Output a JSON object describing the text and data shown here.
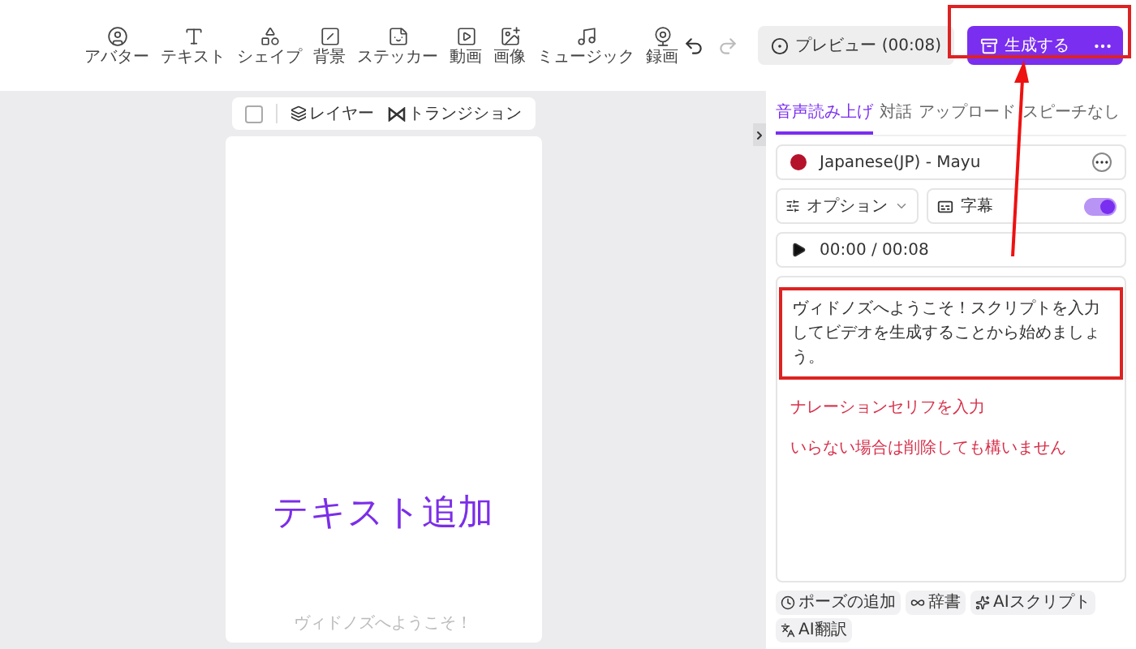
{
  "toolbar": {
    "items": [
      {
        "label": "アバター"
      },
      {
        "label": "テキスト"
      },
      {
        "label": "シェイプ"
      },
      {
        "label": "背景"
      },
      {
        "label": "ステッカー"
      },
      {
        "label": "動画"
      },
      {
        "label": "画像"
      },
      {
        "label": "ミュージック"
      },
      {
        "label": "録画"
      }
    ],
    "preview_button": "プレビュー (00:08)",
    "generate_button": "生成する"
  },
  "canvas_bar": {
    "select": {
      "checked": false
    },
    "layer": "レイヤー",
    "transition": "トランジション"
  },
  "canvas": {
    "heading": "テキスト追加",
    "caption": "ヴィドノズへようこそ！"
  },
  "panel": {
    "tabs": [
      {
        "label": "音声読み上げ",
        "selected": true
      },
      {
        "label": "対話",
        "selected": false
      },
      {
        "label": "アップロード",
        "selected": false
      },
      {
        "label": "スピーチなし",
        "selected": false
      }
    ],
    "voice": {
      "name": "Japanese(JP) - Mayu",
      "color": "#b5132b"
    },
    "options": "オプション",
    "subtitles": {
      "label": "字幕",
      "on": true
    },
    "player": {
      "time": "00:00 / 00:08"
    },
    "script": "ヴィドノズへようこそ！スクリプトを入力してビデオを生成することから始めましょう。",
    "hints": [
      "ナレーションセリフを入力",
      "いらない場合は削除しても構いません"
    ],
    "tools": [
      "ポーズの追加",
      "辞書",
      "AIスクリプト",
      "AI翻訳"
    ]
  }
}
